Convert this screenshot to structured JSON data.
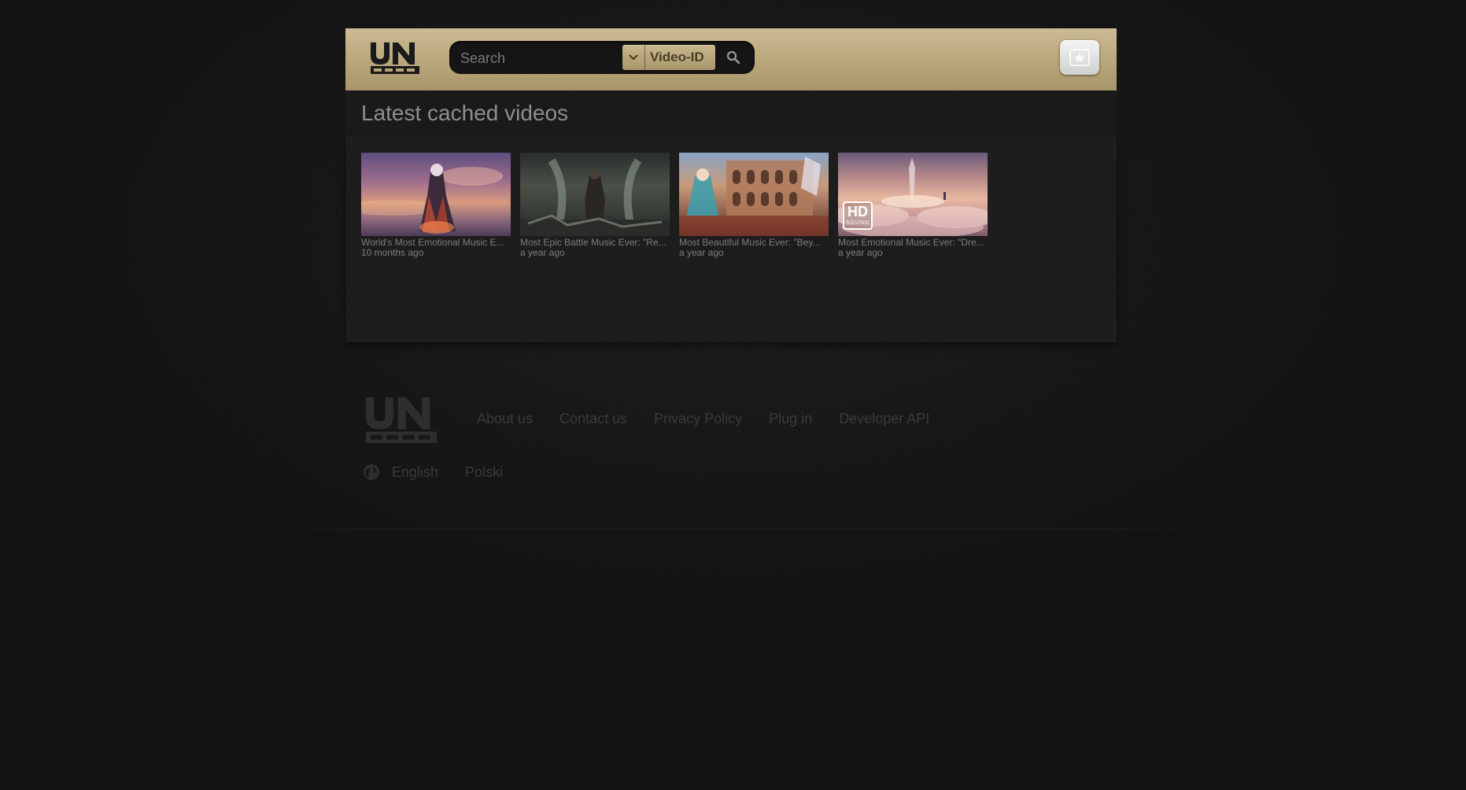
{
  "header": {
    "logo_alt": "UN",
    "search": {
      "placeholder": "Search",
      "value": ""
    },
    "search_type": {
      "selected": "Video-ID"
    },
    "search_button_icon": "magnifier-icon",
    "login_button_icon": "user-icon"
  },
  "main": {
    "section_title": "Latest cached videos",
    "videos": [
      {
        "title": "World's Most Emotional Music E...",
        "age": "10 months ago",
        "hd_badge": false
      },
      {
        "title": "Most Epic Battle Music Ever: \"Re...",
        "age": "a year ago",
        "hd_badge": false
      },
      {
        "title": "Most Beautiful Music Ever: \"Bey...",
        "age": "a year ago",
        "hd_badge": false
      },
      {
        "title": "Most Emotional Music Ever: \"Dre...",
        "age": "a year ago",
        "hd_badge": true,
        "hd_label": "HD",
        "hd_sub": "SOUND"
      }
    ]
  },
  "footer": {
    "links": [
      "About us",
      "Contact us",
      "Privacy Policy",
      "Plug in",
      "Developer API"
    ],
    "languages": [
      "English",
      "Polski"
    ],
    "globe_icon": "globe-icon"
  },
  "colors": {
    "header_gold": "#b9a67b",
    "background": "#161616",
    "panel": "#1d1d1d"
  }
}
